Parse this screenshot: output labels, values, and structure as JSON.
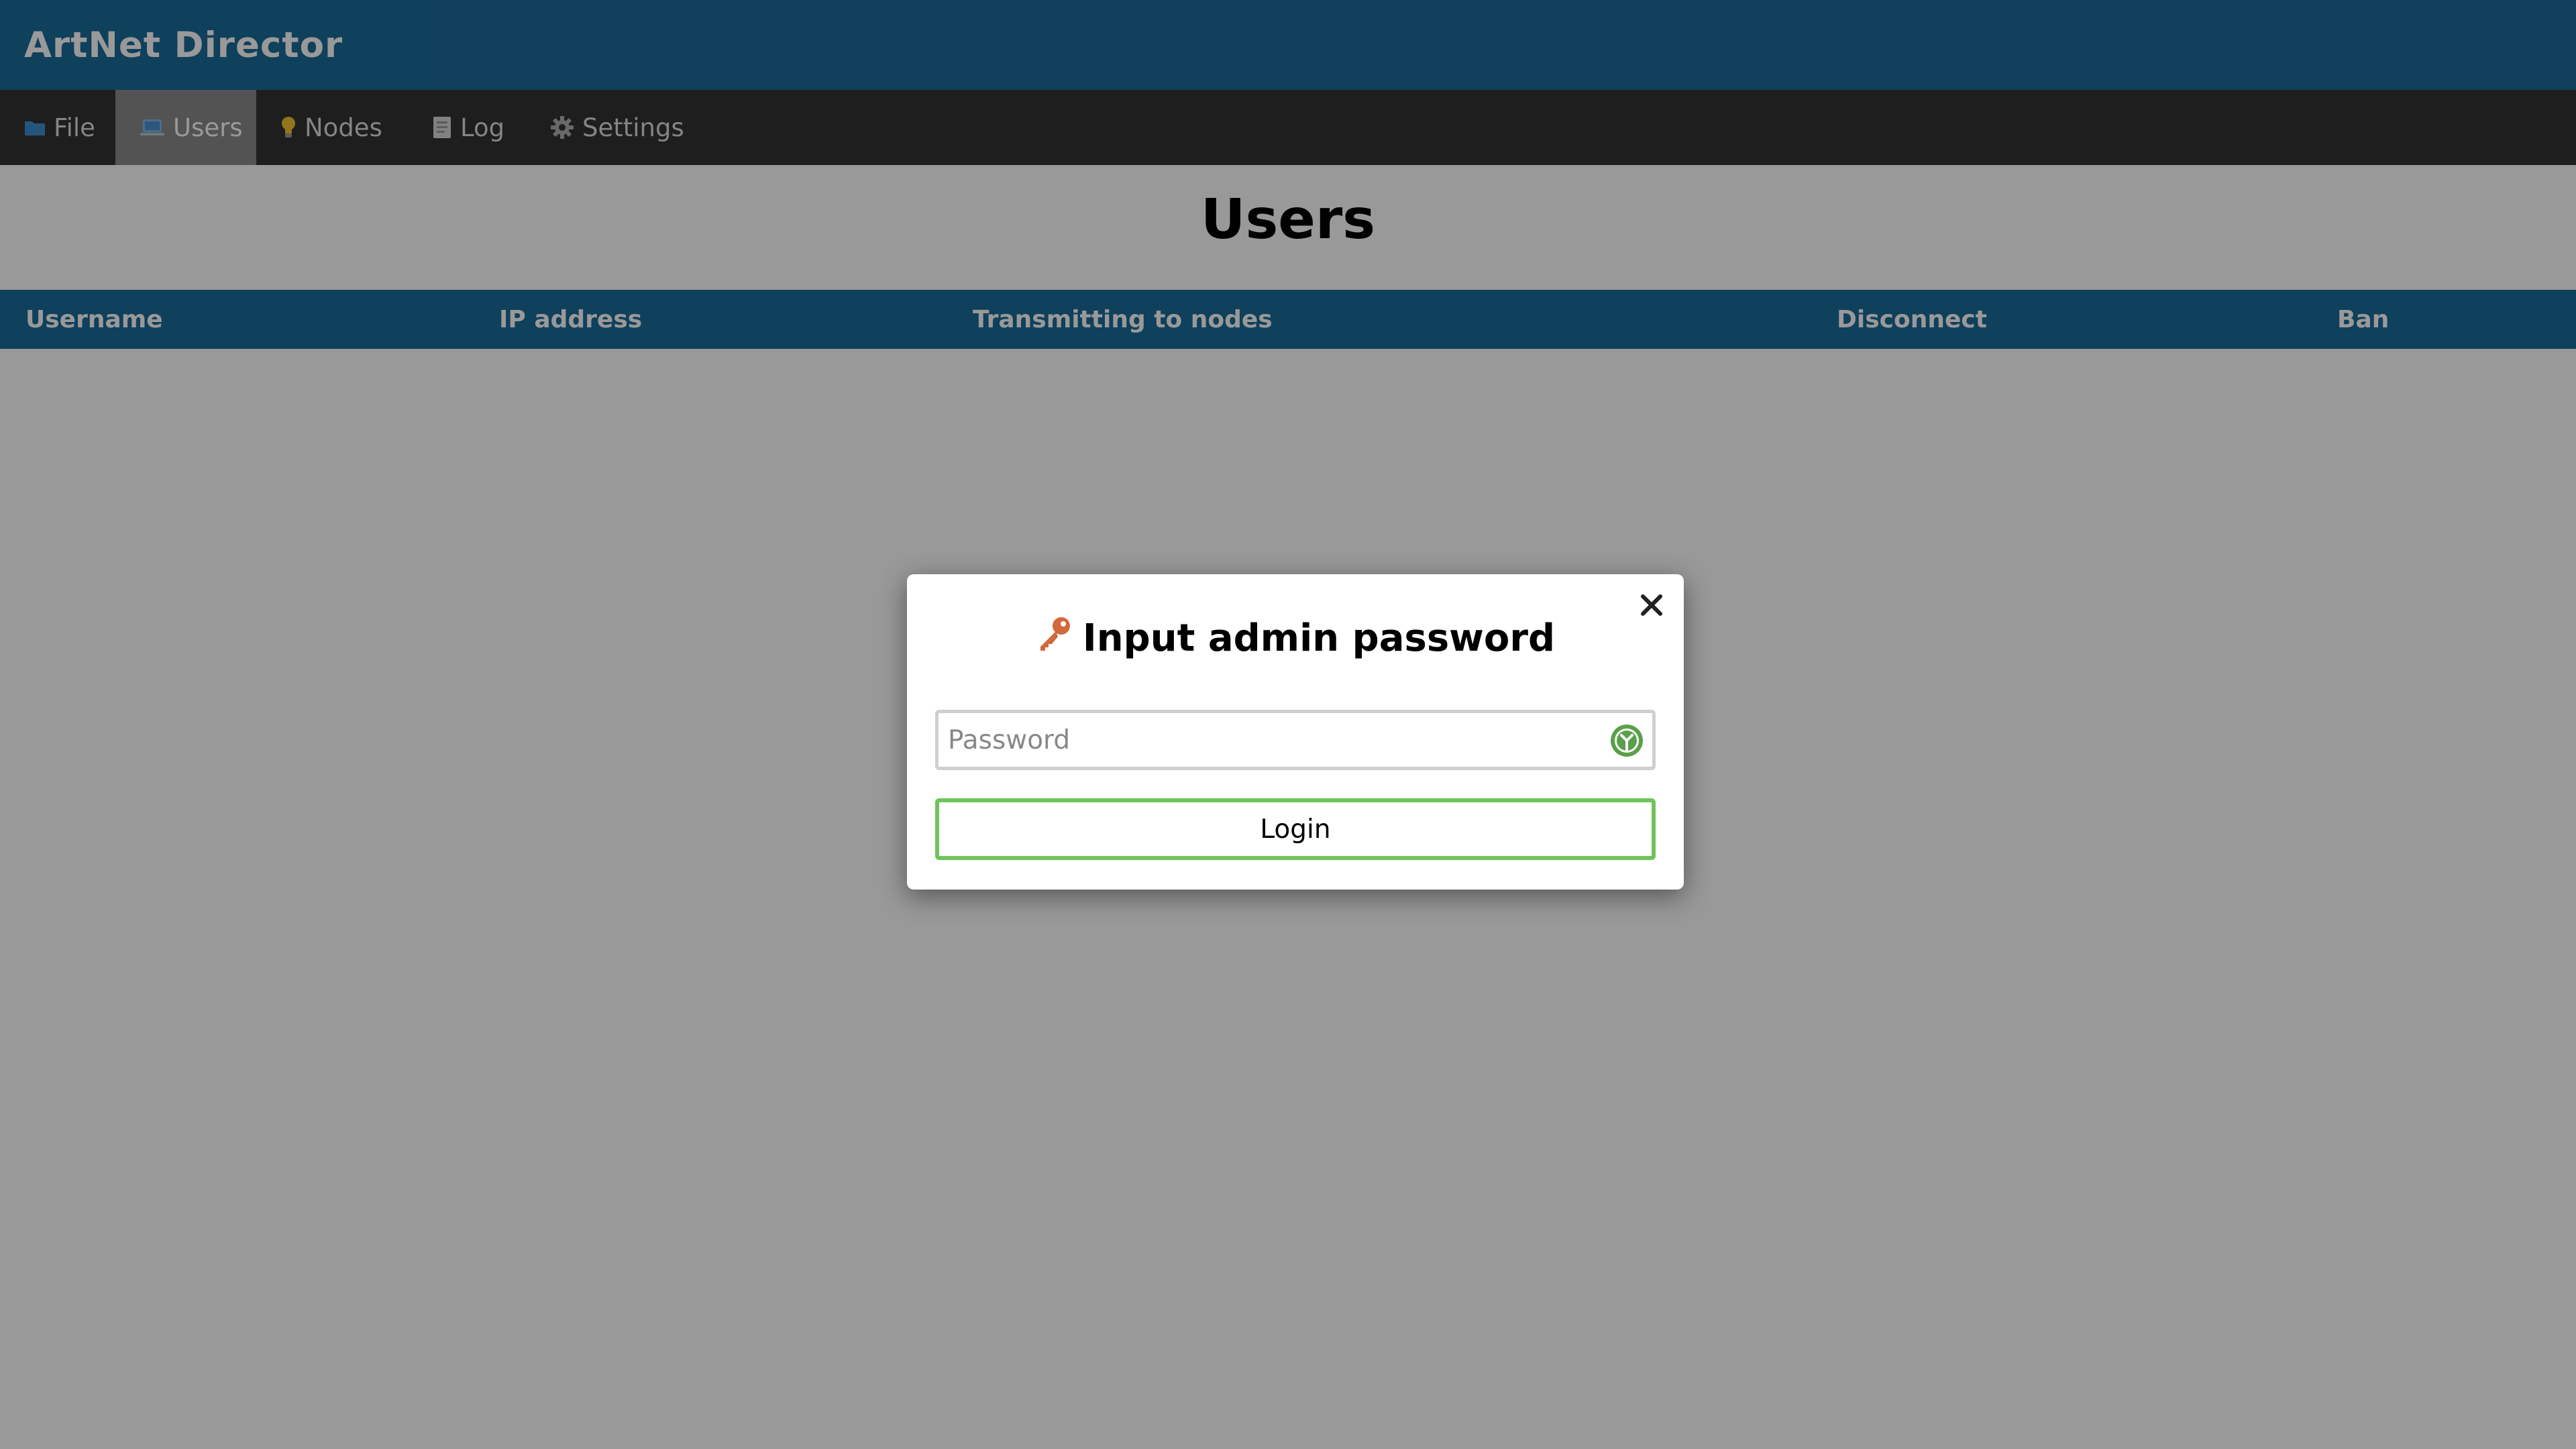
{
  "app": {
    "title": "ArtNet Director"
  },
  "nav": {
    "items": [
      {
        "label": "File",
        "icon": "folder-icon",
        "active": false
      },
      {
        "label": "Users",
        "icon": "laptop-icon",
        "active": true
      },
      {
        "label": "Nodes",
        "icon": "lightbulb-icon",
        "active": false
      },
      {
        "label": "Log",
        "icon": "document-icon",
        "active": false
      },
      {
        "label": "Settings",
        "icon": "gear-icon",
        "active": false
      }
    ]
  },
  "page": {
    "title": "Users"
  },
  "table": {
    "columns": [
      "Username",
      "IP address",
      "Transmitting to nodes",
      "Disconnect",
      "Ban"
    ],
    "rows": []
  },
  "modal": {
    "title": "Input admin password",
    "title_icon": "key-icon",
    "close_icon": "close-icon",
    "password_placeholder": "Password",
    "password_value": "",
    "password_manager_icon": "password-manager-icon",
    "login_label": "Login"
  },
  "colors": {
    "header_bg": "#1a6b9a",
    "nav_bg": "#333333",
    "nav_active_bg": "#8a8a8a",
    "table_header_bg": "#1a6b9a",
    "login_border": "#6ec45a",
    "key_icon": "#d2693c"
  }
}
